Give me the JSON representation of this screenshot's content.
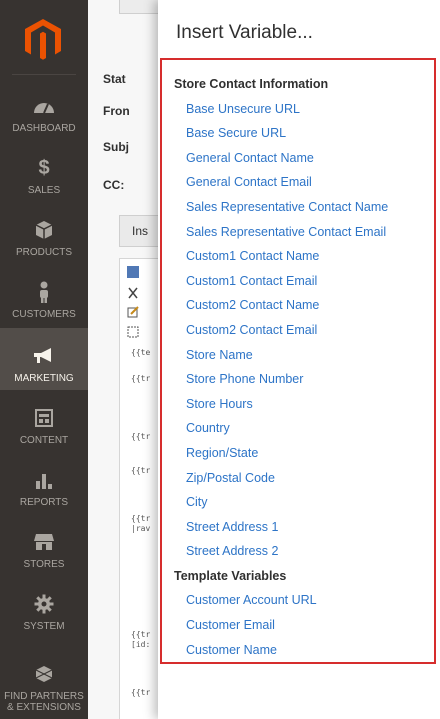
{
  "sidebar": {
    "items": [
      {
        "label": "DASHBOARD",
        "icon": "dashboard-icon"
      },
      {
        "label": "SALES",
        "icon": "dollar-icon"
      },
      {
        "label": "PRODUCTS",
        "icon": "box-icon"
      },
      {
        "label": "CUSTOMERS",
        "icon": "person-icon"
      },
      {
        "label": "MARKETING",
        "icon": "megaphone-icon",
        "active": true
      },
      {
        "label": "CONTENT",
        "icon": "layout-icon"
      },
      {
        "label": "REPORTS",
        "icon": "bar-chart-icon"
      },
      {
        "label": "STORES",
        "icon": "store-icon"
      },
      {
        "label": "SYSTEM",
        "icon": "gear-icon"
      },
      {
        "label": "FIND PARTNERS & EXTENSIONS",
        "icon": "cubes-icon"
      }
    ]
  },
  "background_form": {
    "labels": [
      "Stat",
      "Fron",
      "Subj",
      "CC:"
    ],
    "tab_label": "Ins",
    "code_lines": [
      "{{te",
      "{{tr",
      "{{tr",
      "{{tr",
      "{{tr",
      "|rav",
      "{{tr",
      "[id:",
      "{{tr"
    ]
  },
  "modal": {
    "title": "Insert Variable...",
    "groups": [
      {
        "label": "Store Contact Information",
        "variables": [
          "Base Unsecure URL",
          "Base Secure URL",
          "General Contact Name",
          "General Contact Email",
          "Sales Representative Contact Name",
          "Sales Representative Contact Email",
          "Custom1 Contact Name",
          "Custom1 Contact Email",
          "Custom2 Contact Name",
          "Custom2 Contact Email",
          "Store Name",
          "Store Phone Number",
          "Store Hours",
          "Country",
          "Region/State",
          "Zip/Postal Code",
          "City",
          "Street Address 1",
          "Street Address 2"
        ]
      },
      {
        "label": "Template Variables",
        "variables": [
          "Customer Account URL",
          "Customer Email",
          "Customer Name"
        ]
      }
    ]
  },
  "colors": {
    "sidebar_bg": "#373330",
    "active_bg": "#524d49",
    "link": "#2d74c7",
    "highlight_border": "#d62d2d",
    "logo": "#eb5202"
  }
}
